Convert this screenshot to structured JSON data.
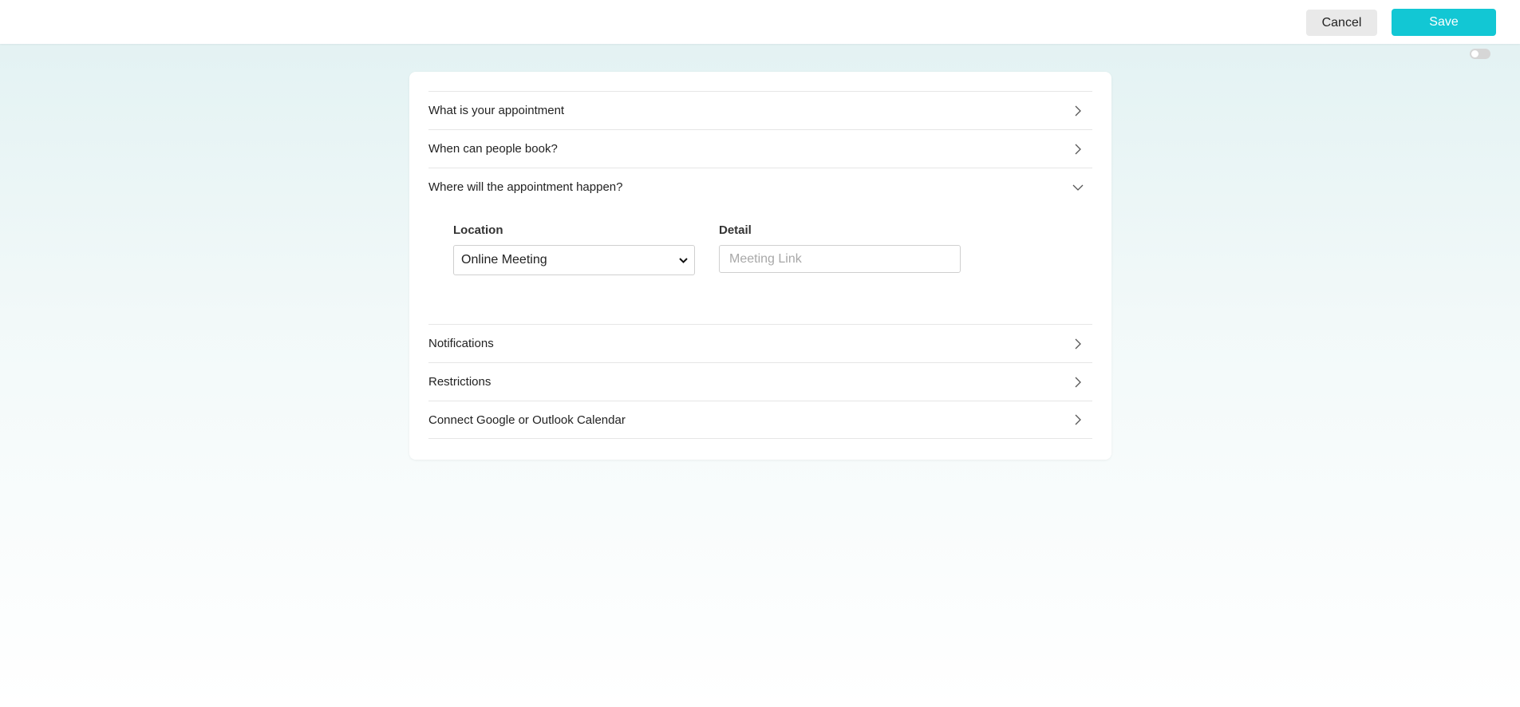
{
  "toolbar": {
    "cancel_label": "Cancel",
    "save_label": "Save"
  },
  "toggle": {
    "on": false
  },
  "sections": [
    {
      "label": "What is your appointment",
      "expanded": false
    },
    {
      "label": "When can people book?",
      "expanded": false
    },
    {
      "label": "Where will the appointment happen?",
      "expanded": true
    },
    {
      "label": "Notifications",
      "expanded": false
    },
    {
      "label": "Restrictions",
      "expanded": false
    },
    {
      "label": "Connect Google or Outlook Calendar",
      "expanded": false
    }
  ],
  "location_form": {
    "location_label": "Location",
    "location_value": "Online Meeting",
    "detail_label": "Detail",
    "detail_placeholder": "Meeting Link",
    "detail_value": ""
  },
  "colors": {
    "accent": "#12c7d4",
    "cancel_bg": "#e9e9e9",
    "background_top": "#e1f1f2"
  },
  "icons": {
    "collapsed": "chevron-right-icon",
    "expanded": "chevron-down-icon",
    "select": "chevron-down-icon"
  }
}
